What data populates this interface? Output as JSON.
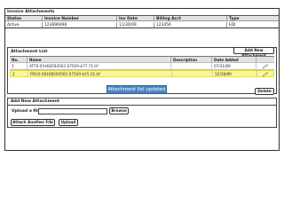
{
  "title": "Invoice Attachments",
  "invoice_header": {
    "columns": [
      "Status",
      "Invoice Number",
      "Inv Date",
      "Billing Acct",
      "Type"
    ],
    "values": [
      "Active",
      "123896498",
      "11/30/09",
      "123456",
      "EDI"
    ]
  },
  "attachment_list": {
    "title": "Attachment List",
    "add_button_label": "Add New Attachment",
    "columns": {
      "no": "No.",
      "name": "Name",
      "description": "Description",
      "date_added": "Date Added"
    },
    "rows": [
      {
        "no": "1",
        "name": "ATTX-05468594562-07509-$77.71.tif",
        "description": "",
        "date_added": "07/31/09"
      },
      {
        "no": "2",
        "name": "PRGX-06468594562-07500-$45.01.tif",
        "description": "",
        "date_added": "12/18/09"
      }
    ],
    "delete_label": "Delete",
    "edit_icon": "pencil-icon"
  },
  "toast": {
    "text": "Attachment list updated"
  },
  "add_new_attachment": {
    "title": "Add New Attachment",
    "upload_label": "Upload a file:",
    "file_value": "",
    "browse_label": "Browse",
    "attach_another_label": "Attach Another File",
    "upload_label_button": "Upload"
  },
  "colors": {
    "highlight": "#fbf78c",
    "toast_bg": "#4a84c3",
    "header_bg": "#e2e2e2"
  }
}
